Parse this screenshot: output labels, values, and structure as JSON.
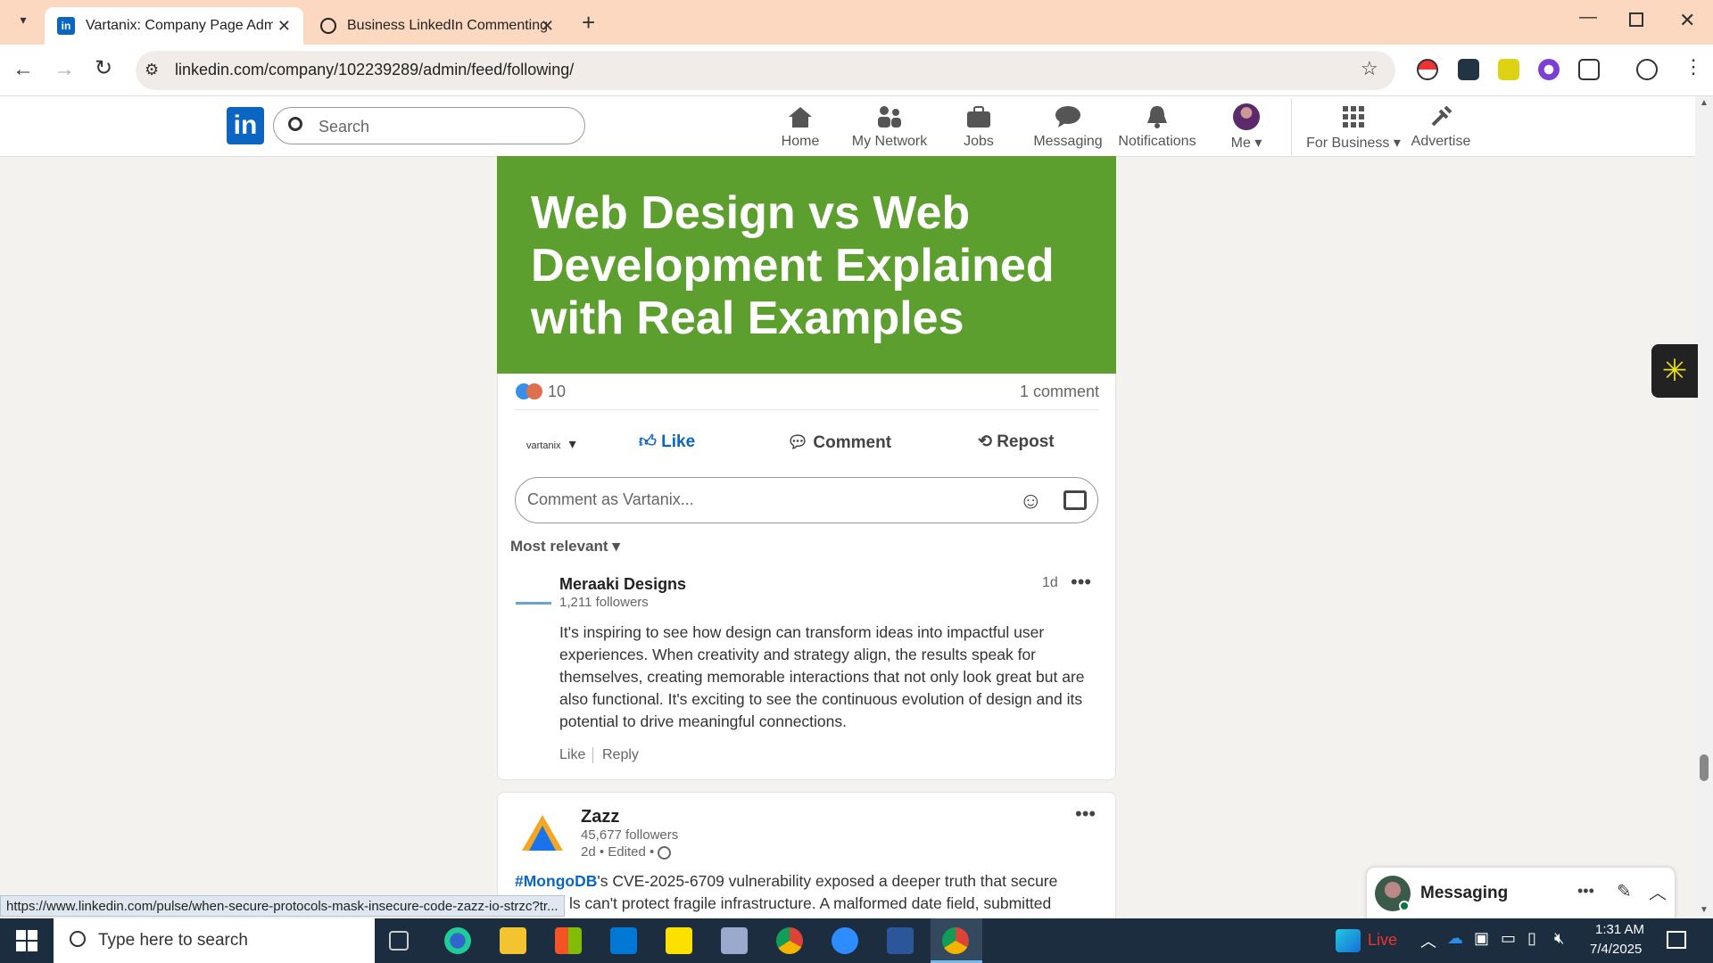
{
  "browser": {
    "tabs": [
      {
        "title": "Vartanix: Company Page Admin",
        "active": true
      },
      {
        "title": "Business LinkedIn Commenting",
        "active": false
      }
    ],
    "url": "linkedin.com/company/102239289/admin/feed/following/"
  },
  "linkedin": {
    "search_placeholder": "Search",
    "nav": [
      {
        "label": "Home",
        "icon": "home-icon"
      },
      {
        "label": "My Network",
        "icon": "network-icon"
      },
      {
        "label": "Jobs",
        "icon": "briefcase-icon"
      },
      {
        "label": "Messaging",
        "icon": "chat-icon"
      },
      {
        "label": "Notifications",
        "icon": "bell-icon"
      },
      {
        "label": "Me",
        "icon": "avatar-icon"
      },
      {
        "label": "For Business",
        "icon": "grid-icon"
      },
      {
        "label": "Advertise",
        "icon": "megaphone-icon"
      }
    ]
  },
  "post": {
    "banner_text": "Web Design vs Web Development Explained with Real Examples",
    "banner_color": "#5c9f2e",
    "reaction_count": "10",
    "comment_count": "1 comment",
    "actor_label": "vartanix",
    "actions": {
      "like": "Like",
      "comment": "Comment",
      "repost": "Repost"
    },
    "comment_placeholder": "Comment as Vartanix...",
    "sort_label": "Most relevant"
  },
  "comments": [
    {
      "author": "Meraaki Designs",
      "followers": "1,211 followers",
      "time": "1d",
      "text": "It's inspiring to see how design can transform ideas into impactful user experiences. When creativity and strategy align, the results speak for themselves, creating memorable interactions that not only look great but are also functional. It's exciting to see the continuous evolution of design and its potential to drive meaningful connections.",
      "like": "Like",
      "reply": "Reply"
    }
  ],
  "post2": {
    "author": "Zazz",
    "followers": "45,677 followers",
    "meta": "2d • Edited •",
    "hashtag": "#MongoDB",
    "text_line1": "'s CVE-2025-6709 vulnerability exposed a deeper truth that secure",
    "text_line2": "ls can't protect fragile infrastructure. A malformed date field, submitted"
  },
  "status_url": "https://www.linkedin.com/pulse/when-secure-protocols-mask-insecure-code-zazz-io-strzc?tr...",
  "messaging": {
    "title": "Messaging"
  },
  "taskbar": {
    "search_placeholder": "Type here to search",
    "live_label": "Live",
    "time": "1:31 AM",
    "date": "7/4/2025"
  }
}
